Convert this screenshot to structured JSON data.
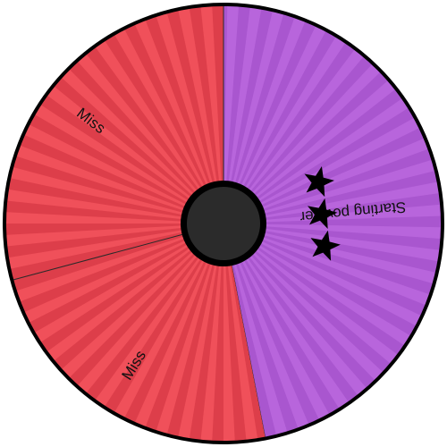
{
  "wheel": {
    "segments": [
      {
        "label": "Starting powder",
        "stars": 3,
        "color": "#b865dc",
        "stripe": "#a956cf",
        "start_deg": -79,
        "end_deg": 90
      },
      {
        "label": "Miss",
        "stars": 0,
        "color": "#f0505a",
        "stripe": "#dd3e4a",
        "start_deg": 90,
        "end_deg": 195
      },
      {
        "label": "Miss",
        "stars": 0,
        "color": "#f0505a",
        "stripe": "#dd3e4a",
        "start_deg": 195,
        "end_deg": 281
      }
    ],
    "hub_color": "#2b2b2b",
    "rim_color": "#000000"
  }
}
